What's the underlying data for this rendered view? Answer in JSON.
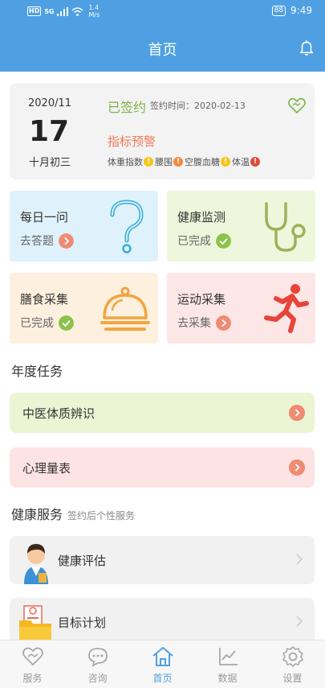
{
  "status_bar": {
    "network": "HD",
    "signal_type": "5G",
    "speed_value": "1.4",
    "speed_unit": "M/s",
    "battery": "88",
    "time": "9:49"
  },
  "header": {
    "title": "首页",
    "bell_icon": "bell-icon"
  },
  "sign_card": {
    "year_month": "2020/11",
    "day": "17",
    "lunar_date": "十月初三",
    "signed_label": "已签约",
    "sign_time_label": "签约时间：",
    "sign_time_value": "2020-02-13",
    "warning_title": "指标预警",
    "indicators": [
      {
        "label": "体重指数",
        "mark": "!",
        "color": "#f5c518"
      },
      {
        "label": "腰围",
        "mark": "!",
        "color": "#f08a3e"
      },
      {
        "label": "空腹血糖",
        "mark": "!",
        "color": "#f5c518"
      },
      {
        "label": "体温",
        "mark": "!",
        "color": "#e04a3c"
      }
    ]
  },
  "tiles": [
    {
      "title": "每日一问",
      "status": "去答题",
      "state": "todo",
      "bg": "#dff2fb",
      "icon": "question-icon"
    },
    {
      "title": "健康监测",
      "status": "已完成",
      "state": "done",
      "bg": "#eef7dc",
      "icon": "stethoscope-icon"
    },
    {
      "title": "膳食采集",
      "status": "已完成",
      "state": "done",
      "bg": "#fdf0df",
      "icon": "cloche-icon"
    },
    {
      "title": "运动采集",
      "status": "去采集",
      "state": "todo",
      "bg": "#fde6e6",
      "icon": "runner-icon"
    }
  ],
  "annual_tasks": {
    "title": "年度任务",
    "items": [
      {
        "label": "中医体质辨识",
        "bg": "#ebf5d4"
      },
      {
        "label": "心理量表",
        "bg": "#fde3e3"
      }
    ]
  },
  "health_services": {
    "title": "健康服务",
    "subtitle": "签约后个性服务",
    "items": [
      {
        "label": "健康评估",
        "icon": "doctor-avatar"
      },
      {
        "label": "目标计划",
        "icon": "folder-icon"
      }
    ]
  },
  "tabbar": {
    "tabs": [
      {
        "label": "服务",
        "icon": "heart-hands-icon",
        "active": false
      },
      {
        "label": "咨询",
        "icon": "chat-bubble-icon",
        "active": false
      },
      {
        "label": "首页",
        "icon": "home-icon",
        "active": true
      },
      {
        "label": "数据",
        "icon": "line-chart-icon",
        "active": false
      },
      {
        "label": "设置",
        "icon": "gear-icon",
        "active": false
      }
    ]
  },
  "colors": {
    "primary": "#4fa0e2",
    "signed_green": "#7cb342",
    "warning": "#f07a5a",
    "todo_badge": "#f08b73",
    "done_badge": "#8bc34a"
  }
}
